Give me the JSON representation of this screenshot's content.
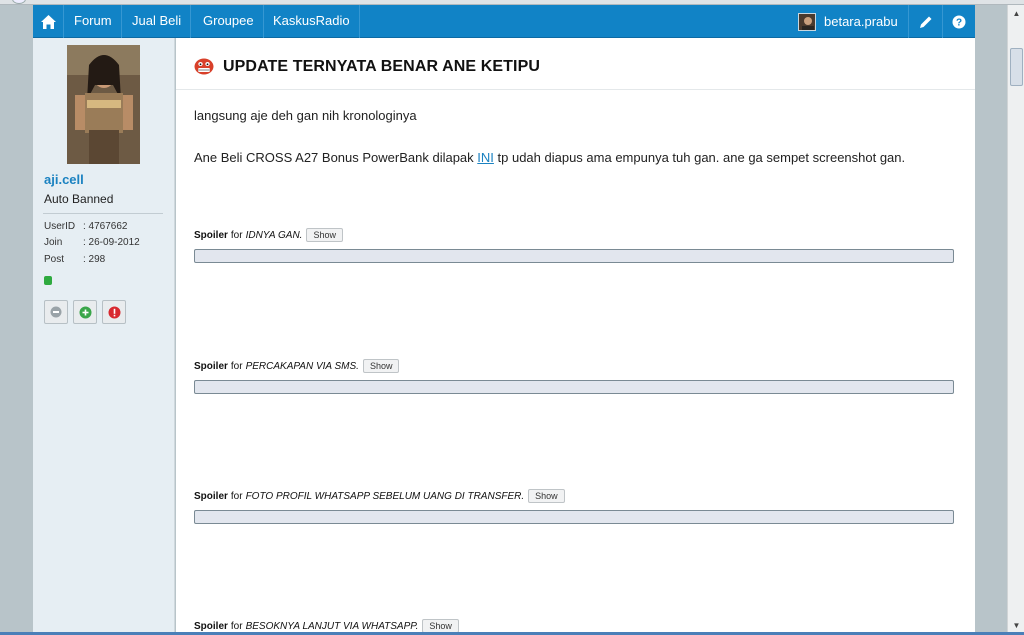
{
  "nav": {
    "items": [
      "Forum",
      "Jual Beli",
      "Groupee",
      "KaskusRadio"
    ],
    "username": "betara.prabu"
  },
  "sidebar": {
    "username": "aji.cell",
    "user_title": "Auto Banned",
    "info": [
      {
        "label": "UserID",
        "value": ": 4767662"
      },
      {
        "label": "Join",
        "value": ": 26-09-2012"
      },
      {
        "label": "Post",
        "value": ": 298"
      }
    ]
  },
  "post": {
    "title": "UPDATE TERNYATA BENAR ANE KETIPU",
    "para1": "langsung aje deh gan nih kronologinya",
    "para2_before": "Ane Beli CROSS A27 Bonus PowerBank dilapak ",
    "para2_link": "INI",
    "para2_after": " tp udah diapus ama empunya tuh gan. ane ga sempet screenshot gan."
  },
  "spoilers": [
    {
      "prefix": "Spoiler",
      "for_text": "for",
      "title": "IDNYA GAN.",
      "show_label": "Show"
    },
    {
      "prefix": "Spoiler",
      "for_text": "for",
      "title": "PERCAKAPAN VIA SMS.",
      "show_label": "Show"
    },
    {
      "prefix": "Spoiler",
      "for_text": "for",
      "title": "FOTO PROFIL WHATSAPP SEBELUM UANG DI TRANSFER.",
      "show_label": "Show"
    },
    {
      "prefix": "Spoiler",
      "for_text": "for",
      "title": "BESOKNYA LANJUT VIA WHATSAPP.",
      "show_label": "Show"
    }
  ],
  "colors": {
    "navbar": "#1183c6",
    "link": "#1b82c1",
    "online": "#2eaa3f"
  },
  "icons": {
    "home": "home-icon",
    "edit": "pencil-icon",
    "help": "question-icon"
  }
}
